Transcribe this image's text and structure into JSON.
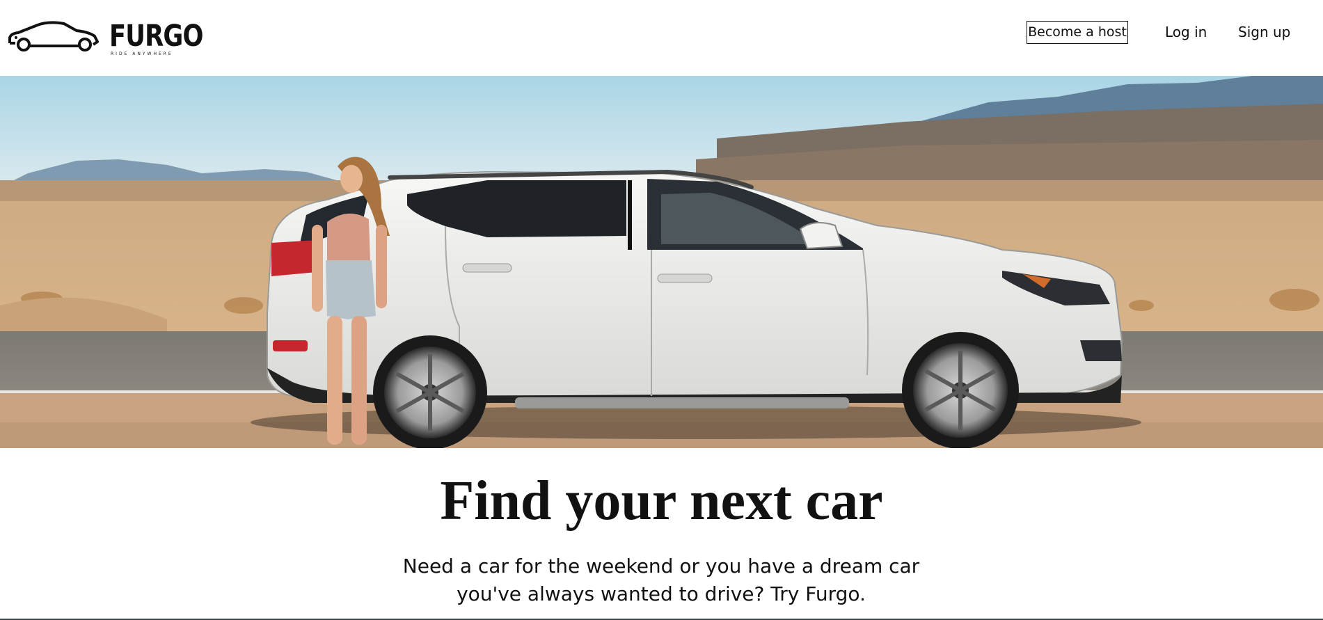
{
  "brand": {
    "name": "FURGO",
    "tagline": "RIDE ANYWHERE"
  },
  "nav": {
    "become_host": "Become a host",
    "login": "Log in",
    "signup": "Sign up"
  },
  "hero": {
    "image_subject": "white SUV parked on a desert road with a woman leaning on it"
  },
  "main": {
    "headline": "Find your next car",
    "subtext_line1": "Need a car for the weekend or you have a dream car",
    "subtext_line2": "you've always wanted to drive? Try Furgo."
  },
  "colors": {
    "text": "#111111",
    "background": "#ffffff"
  }
}
